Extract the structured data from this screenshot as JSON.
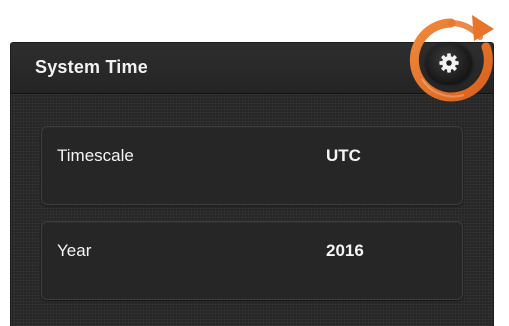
{
  "panel": {
    "title": "System Time",
    "settings_icon": "gear-icon",
    "rows": [
      {
        "label": "Timescale",
        "value": "UTC"
      },
      {
        "label": "Year",
        "value": "2016"
      }
    ]
  },
  "colors": {
    "panel_bg": "#262626",
    "header_bg": "#2a2a2a",
    "text": "#f4f4f4",
    "highlight_ring": "#e8742a"
  }
}
